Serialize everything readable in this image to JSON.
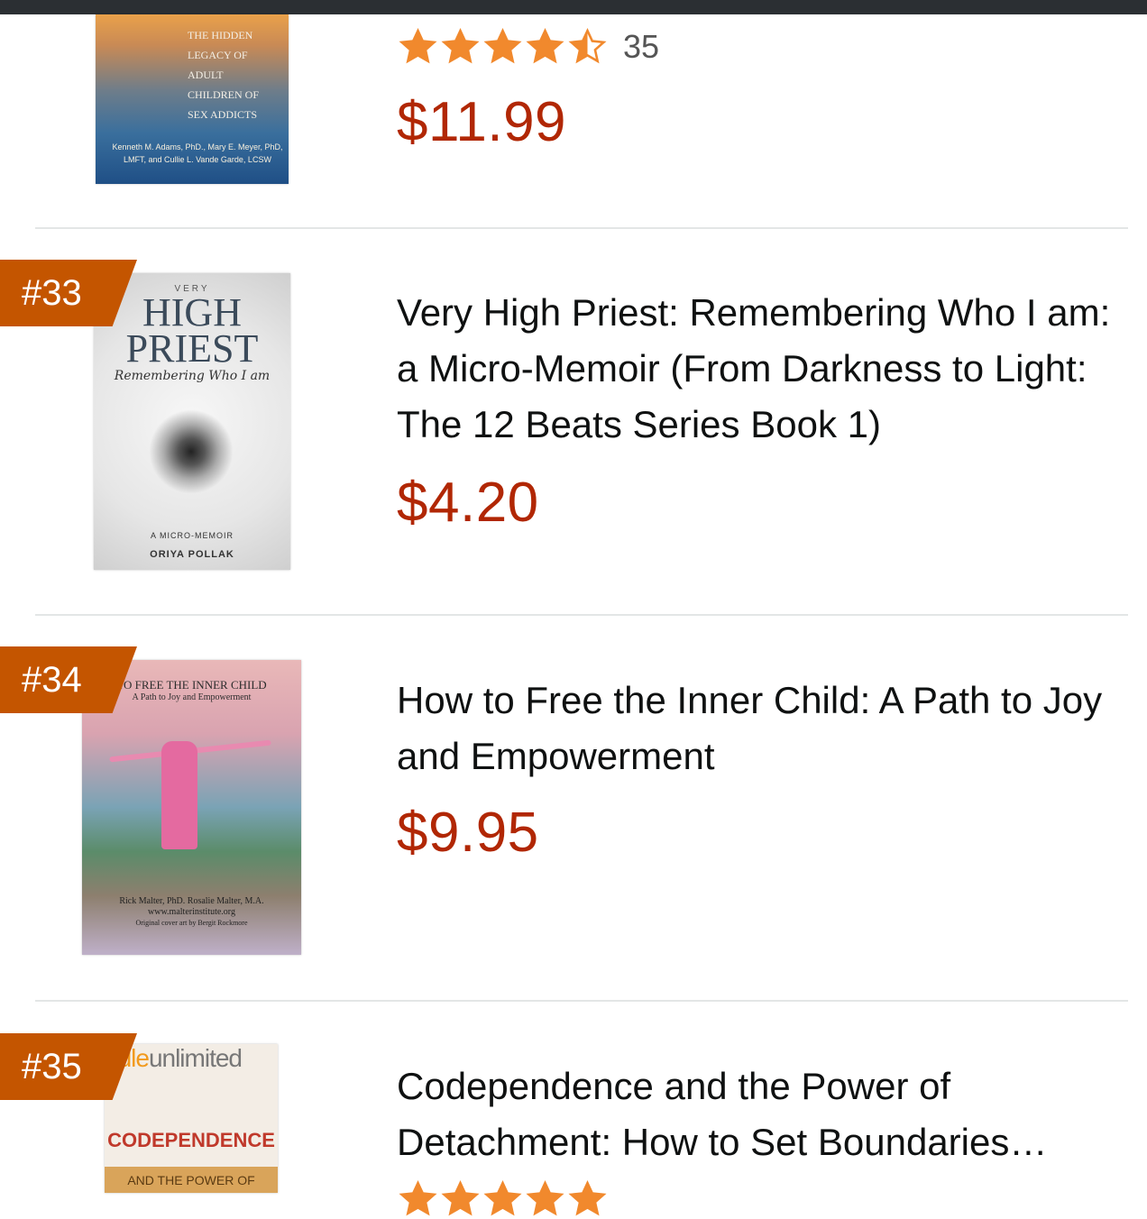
{
  "items": [
    {
      "rank": "",
      "title": "",
      "rating_count": "35",
      "rating_value": 4.5,
      "price": "$11.99",
      "cover": {
        "title": "THE HIDDEN LEGACY OF ADULT CHILDREN OF SEX ADDICTS",
        "authors": "Kenneth M. Adams, PhD., Mary E. Meyer, PhD, LMFT, and Cullie L. Vande Garde, LCSW"
      }
    },
    {
      "rank": "#33",
      "title": "Very High Priest: Remembering Who I am: a Micro-Memoir (From Darkness to Light: The 12 Beats Series Book 1)",
      "price": "$4.20",
      "cover": {
        "very": "VERY",
        "high": "HIGH",
        "priest": "PRIEST",
        "subtitle": "Remembering Who I am",
        "micro": "A MICRO-MEMOIR",
        "author": "ORIYA POLLAK"
      }
    },
    {
      "rank": "#34",
      "title": "How to Free the Inner Child: A Path to Joy and Empowerment",
      "price": "$9.95",
      "cover": {
        "title": "TO FREE THE INNER CHILD",
        "subtitle": "A Path to Joy and Empowerment",
        "authors": "Rick Malter, PhD.   Rosalie Malter, M.A.",
        "site": "www.malterinstitute.org",
        "credit": "Original cover art by Bergit Rockmore"
      }
    },
    {
      "rank": "#35",
      "title": "Codependence and the Power of Detachment: How to Set Boundaries…",
      "cover": {
        "brand_a": "ndle",
        "brand_b": "unlimited",
        "title": "CODEPENDENCE",
        "strip": "AND THE POWER OF"
      }
    }
  ],
  "colors": {
    "rank_badge": "#c45500",
    "price": "#b12704",
    "star": "#f1892d"
  }
}
